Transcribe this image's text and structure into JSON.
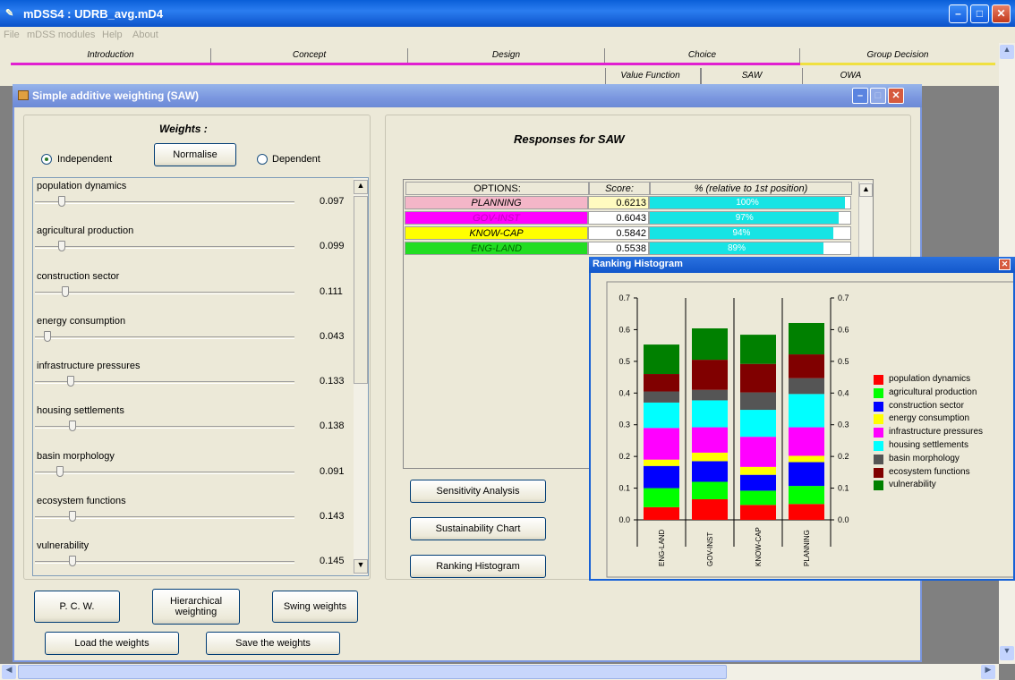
{
  "window": {
    "title": "mDSS4 : UDRB_avg.mD4"
  },
  "menu": [
    "File",
    "mDSS modules",
    "Help",
    "About"
  ],
  "tabs": [
    "Introduction",
    "Concept",
    "Design",
    "Choice",
    "Group Decision"
  ],
  "subtabs": [
    "Value Function",
    "SAW",
    "OWA"
  ],
  "child": {
    "title": "Simple additive weighting (SAW)"
  },
  "weights": {
    "heading": "Weights :",
    "independent": "Independent",
    "dependent": "Dependent",
    "normalise": "Normalise",
    "items": [
      {
        "label": "population dynamics",
        "value": "0.097"
      },
      {
        "label": "agricultural production",
        "value": "0.099"
      },
      {
        "label": "construction sector",
        "value": "0.111"
      },
      {
        "label": "energy consumption",
        "value": "0.043"
      },
      {
        "label": "infrastructure pressures",
        "value": "0.133"
      },
      {
        "label": "housing settlements",
        "value": "0.138"
      },
      {
        "label": "basin morphology",
        "value": "0.091"
      },
      {
        "label": "ecosystem functions",
        "value": "0.143"
      },
      {
        "label": "vulnerability",
        "value": "0.145"
      }
    ]
  },
  "buttons": {
    "pcw": "P. C. W.",
    "hier": "Hierarchical weighting",
    "swing": "Swing weights",
    "load": "Load the weights",
    "save": "Save the weights",
    "sens": "Sensitivity Analysis",
    "sust": "Sustainability Chart",
    "rank": "Ranking Histogram"
  },
  "responses": {
    "heading": "Responses for SAW",
    "col_options": "OPTIONS:",
    "col_score": "Score:",
    "col_pct": "% (relative to 1st position)",
    "rows": [
      {
        "option": "PLANNING",
        "score": "0.6213",
        "pct": "100%",
        "pct_value": 100,
        "color": "#f4b6c8"
      },
      {
        "option": "GOV-INST",
        "score": "0.6043",
        "pct": "97%",
        "pct_value": 97,
        "color": "#ff00ff"
      },
      {
        "option": "KNOW-CAP",
        "score": "0.5842",
        "pct": "94%",
        "pct_value": 94,
        "color": "#ffff00"
      },
      {
        "option": "ENG-LAND",
        "score": "0.5538",
        "pct": "89%",
        "pct_value": 89,
        "color": "#22dd22"
      }
    ]
  },
  "histogram": {
    "title": "Ranking Histogram"
  },
  "chart_data": {
    "type": "bar",
    "stacked": true,
    "categories": [
      "ENG-LAND",
      "GOV-INST",
      "KNOW-CAP",
      "PLANNING"
    ],
    "ylim": [
      0,
      0.7
    ],
    "yticks": [
      "0.0",
      "0.1",
      "0.2",
      "0.3",
      "0.4",
      "0.5",
      "0.6",
      "0.7"
    ],
    "series": [
      {
        "name": "population dynamics",
        "color": "#ff0000",
        "values": [
          0.04,
          0.065,
          0.047,
          0.05
        ]
      },
      {
        "name": "agricultural production",
        "color": "#00ff00",
        "values": [
          0.06,
          0.055,
          0.045,
          0.057
        ]
      },
      {
        "name": "construction sector",
        "color": "#0000ff",
        "values": [
          0.07,
          0.065,
          0.05,
          0.075
        ]
      },
      {
        "name": "energy consumption",
        "color": "#ffff00",
        "values": [
          0.02,
          0.027,
          0.025,
          0.02
        ]
      },
      {
        "name": "infrastructure pressures",
        "color": "#ff00ff",
        "values": [
          0.1,
          0.08,
          0.095,
          0.09
        ]
      },
      {
        "name": "housing settlements",
        "color": "#00ffff",
        "values": [
          0.08,
          0.085,
          0.085,
          0.105
        ]
      },
      {
        "name": "basin morphology",
        "color": "#555555",
        "values": [
          0.035,
          0.033,
          0.055,
          0.05
        ]
      },
      {
        "name": "ecosystem functions",
        "color": "#800000",
        "values": [
          0.055,
          0.095,
          0.09,
          0.075
        ]
      },
      {
        "name": "vulnerability",
        "color": "#008000",
        "values": [
          0.093,
          0.099,
          0.092,
          0.099
        ]
      }
    ],
    "legend": "right"
  }
}
